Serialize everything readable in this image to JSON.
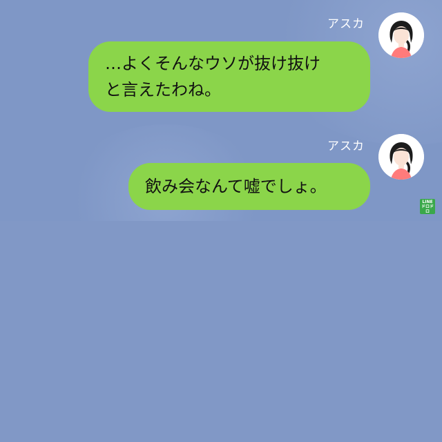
{
  "messages": [
    {
      "sender": "アスカ",
      "lines": [
        "…よくそんなウソが抜け抜け",
        "と言えたわね。"
      ]
    },
    {
      "sender": "アスカ",
      "lines": [
        "飲み会なんて嘘でしょ。"
      ]
    }
  ],
  "badge": {
    "line1": "LINE",
    "line2": "ドロドロ"
  },
  "icons": {
    "avatar": "woman-avatar-icon"
  },
  "colors": {
    "background": "#8198c6",
    "bubble": "#8bd54a",
    "badge": "#3aa84a"
  }
}
